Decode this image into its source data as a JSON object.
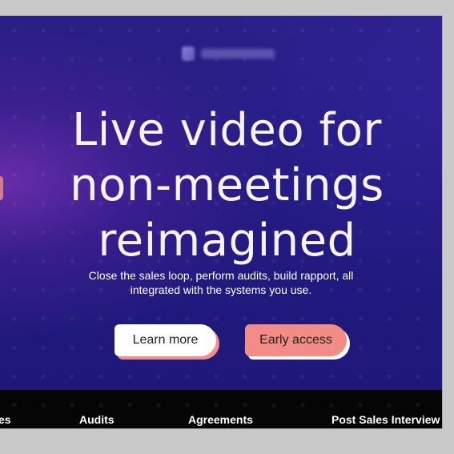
{
  "hero": {
    "title_line1": "Live video for",
    "title_line2": "non-meetings",
    "title_line3": "reimagined",
    "subtitle_line1": "Close the sales loop, perform audits, build rapport, all",
    "subtitle_line2": "integrated with the systems you use."
  },
  "buttons": {
    "learn_more": "Learn more",
    "early_access": "Early access"
  },
  "nav": {
    "items": [
      "es",
      "Audits",
      "Agreements",
      "Post Sales Interview"
    ]
  },
  "colors": {
    "background": "#221a80",
    "accent": "#f38b87",
    "nav_bar": "#050505"
  }
}
